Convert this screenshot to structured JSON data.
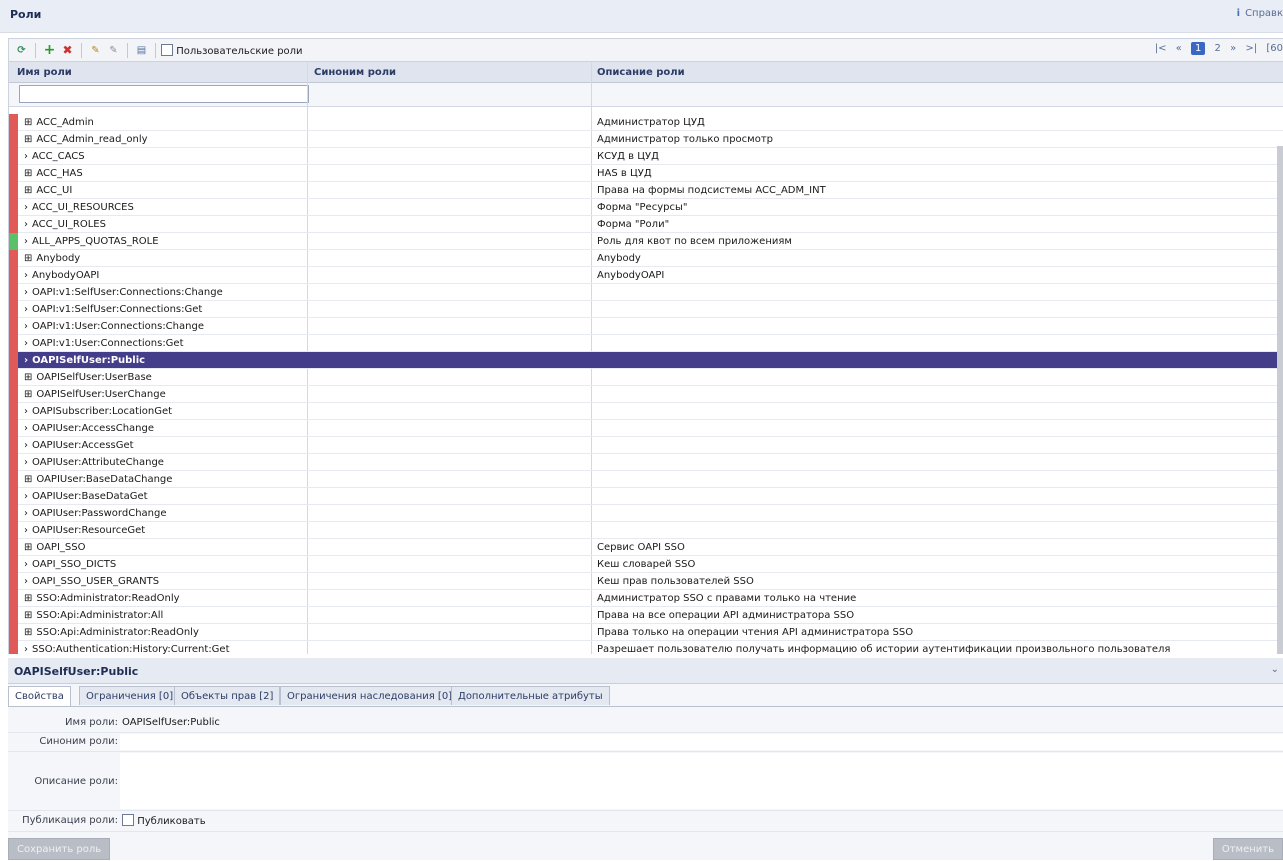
{
  "header": {
    "title": "Роли",
    "help_label": "Справк"
  },
  "toolbar": {
    "custom_roles_label": "Пользовательские роли",
    "pager": {
      "first": "|<",
      "prev": "«",
      "current_page": "1",
      "next_page": "2",
      "next": "»",
      "last": ">|",
      "total": "[60"
    }
  },
  "grid": {
    "columns": [
      "Имя роли",
      "Синоним роли",
      "Описание роли"
    ],
    "rows": [
      {
        "expander": "⊞",
        "name": "ACC_Admin",
        "desc": "Администратор ЦУД",
        "mark": "#e05a5a"
      },
      {
        "expander": "⊞",
        "name": "ACC_Admin_read_only",
        "desc": "Администратор только просмотр",
        "mark": "#e05a5a"
      },
      {
        "expander": "›",
        "name": "ACC_CACS",
        "desc": "КСУД в ЦУД",
        "mark": "#e05a5a"
      },
      {
        "expander": "⊞",
        "name": "ACC_HAS",
        "desc": "HAS в ЦУД",
        "mark": "#e05a5a"
      },
      {
        "expander": "⊞",
        "name": "ACC_UI",
        "desc": "Права на формы подсистемы ACC_ADM_INT",
        "mark": "#e05a5a"
      },
      {
        "expander": "›",
        "name": "ACC_UI_RESOURCES",
        "desc": "Форма \"Ресурсы\"",
        "mark": "#e05a5a"
      },
      {
        "expander": "›",
        "name": "ACC_UI_ROLES",
        "desc": "Форма \"Роли\"",
        "mark": "#e05a5a"
      },
      {
        "expander": "›",
        "name": "ALL_APPS_QUOTAS_ROLE",
        "desc": "Роль для квот по всем приложениям",
        "mark": "#5cbf6a"
      },
      {
        "expander": "⊞",
        "name": "Anybody",
        "desc": "Anybody",
        "mark": "#e05a5a"
      },
      {
        "expander": "›",
        "name": "AnybodyOAPI",
        "desc": "AnybodyOAPI",
        "mark": "#e05a5a"
      },
      {
        "expander": "›",
        "name": "OAPI:v1:SelfUser:Connections:Change",
        "desc": "",
        "mark": "#e05a5a"
      },
      {
        "expander": "›",
        "name": "OAPI:v1:SelfUser:Connections:Get",
        "desc": "",
        "mark": "#e05a5a"
      },
      {
        "expander": "›",
        "name": "OAPI:v1:User:Connections:Change",
        "desc": "",
        "mark": "#e05a5a"
      },
      {
        "expander": "›",
        "name": "OAPI:v1:User:Connections:Get",
        "desc": "",
        "mark": "#e05a5a"
      },
      {
        "expander": "›",
        "name": "OAPISelfUser:Public",
        "desc": "",
        "mark": "#e05a5a",
        "selected": true
      },
      {
        "expander": "⊞",
        "name": "OAPISelfUser:UserBase",
        "desc": "",
        "mark": "#e05a5a"
      },
      {
        "expander": "⊞",
        "name": "OAPISelfUser:UserChange",
        "desc": "",
        "mark": "#e05a5a"
      },
      {
        "expander": "›",
        "name": "OAPISubscriber:LocationGet",
        "desc": "",
        "mark": "#e05a5a"
      },
      {
        "expander": "›",
        "name": "OAPIUser:AccessChange",
        "desc": "",
        "mark": "#e05a5a"
      },
      {
        "expander": "›",
        "name": "OAPIUser:AccessGet",
        "desc": "",
        "mark": "#e05a5a"
      },
      {
        "expander": "›",
        "name": "OAPIUser:AttributeChange",
        "desc": "",
        "mark": "#e05a5a"
      },
      {
        "expander": "⊞",
        "name": "OAPIUser:BaseDataChange",
        "desc": "",
        "mark": "#e05a5a"
      },
      {
        "expander": "›",
        "name": "OAPIUser:BaseDataGet",
        "desc": "",
        "mark": "#e05a5a"
      },
      {
        "expander": "›",
        "name": "OAPIUser:PasswordChange",
        "desc": "",
        "mark": "#e05a5a"
      },
      {
        "expander": "›",
        "name": "OAPIUser:ResourceGet",
        "desc": "",
        "mark": "#e05a5a"
      },
      {
        "expander": "⊞",
        "name": "OAPI_SSO",
        "desc": "Сервис OAPI SSO",
        "mark": "#e05a5a"
      },
      {
        "expander": "›",
        "name": "OAPI_SSO_DICTS",
        "desc": "Кеш словарей SSO",
        "mark": "#e05a5a"
      },
      {
        "expander": "›",
        "name": "OAPI_SSO_USER_GRANTS",
        "desc": "Кеш прав пользователей SSO",
        "mark": "#e05a5a"
      },
      {
        "expander": "⊞",
        "name": "SSO:Administrator:ReadOnly",
        "desc": "Администратор SSO с правами только на чтение",
        "mark": "#e05a5a"
      },
      {
        "expander": "⊞",
        "name": "SSO:Api:Administrator:All",
        "desc": "Права на все операции API администратора SSO",
        "mark": "#e05a5a"
      },
      {
        "expander": "⊞",
        "name": "SSO:Api:Administrator:ReadOnly",
        "desc": "Права только на операции чтения API администратора SSO",
        "mark": "#e05a5a"
      },
      {
        "expander": "›",
        "name": "SSO:Authentication:History:Current:Get",
        "desc": "Разрешает пользователю получать информацию об истории аутентификации произвольного пользователя",
        "mark": "#e05a5a"
      }
    ]
  },
  "detail": {
    "title": "OAPISelfUser:Public",
    "tabs": [
      "Свойства",
      "Ограничения [0]",
      "Объекты прав [2]",
      "Ограничения наследования [0]",
      "Дополнительные атрибуты"
    ],
    "fields": {
      "name_label": "Имя роли:",
      "name_value": "OAPISelfUser:Public",
      "synonym_label": "Синоним роли:",
      "synonym_value": "",
      "description_label": "Описание роли:",
      "description_value": "",
      "publish_label": "Публикация роли:",
      "publish_checkbox_label": "Публиковать"
    },
    "buttons": {
      "save": "Сохранить роль",
      "cancel": "Отменить"
    }
  }
}
